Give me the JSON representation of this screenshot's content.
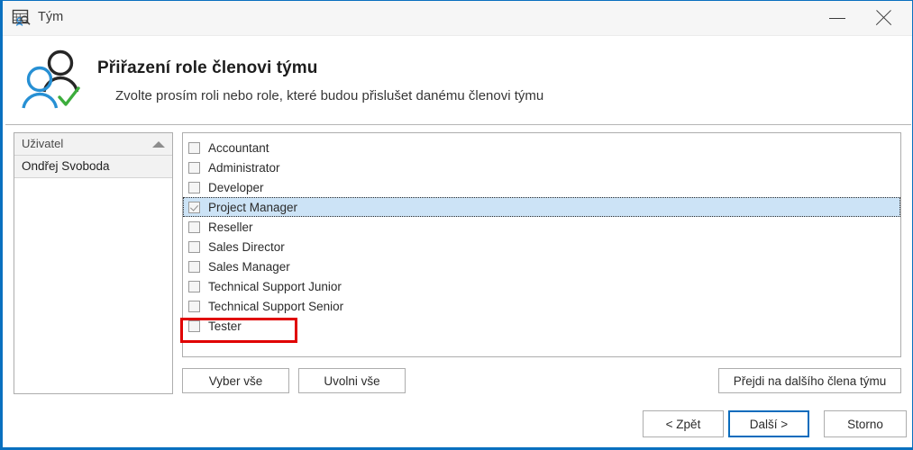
{
  "window": {
    "title": "Tým",
    "title_icon": "team-search-icon",
    "minimize_label": "minimize",
    "close_label": "close",
    "accent_color": "#0a70bf"
  },
  "header": {
    "icon": "two-users-check-icon",
    "title": "Přiřazení role členovi týmu",
    "subtitle": "Zvolte prosím roli nebo role, které budou přislušet danému členovi týmu"
  },
  "users_panel": {
    "column_header": "Uživatel",
    "sort_direction": "ascending",
    "rows": [
      {
        "name": "Ondřej Svoboda"
      }
    ]
  },
  "roles_panel": {
    "roles": [
      {
        "label": "Accountant",
        "checked": false,
        "selected": false
      },
      {
        "label": "Administrator",
        "checked": false,
        "selected": false
      },
      {
        "label": "Developer",
        "checked": false,
        "selected": false
      },
      {
        "label": "Project Manager",
        "checked": true,
        "selected": true
      },
      {
        "label": "Reseller",
        "checked": false,
        "selected": false
      },
      {
        "label": "Sales Director",
        "checked": false,
        "selected": false
      },
      {
        "label": "Sales Manager",
        "checked": false,
        "selected": false
      },
      {
        "label": "Technical Support Junior",
        "checked": false,
        "selected": false
      },
      {
        "label": "Technical Support Senior",
        "checked": false,
        "selected": false
      },
      {
        "label": "Tester",
        "checked": false,
        "selected": false
      }
    ]
  },
  "annotation": {
    "color": "#e00000",
    "target": "Project Manager"
  },
  "list_buttons": {
    "select_all": "Vyber vše",
    "deselect_all": "Uvolni vše",
    "next_member": "Přejdi na dalšího člena týmu"
  },
  "wizard_buttons": {
    "back": "< Zpět",
    "next": "Další >",
    "cancel": "Storno",
    "default_button": "Další >"
  }
}
